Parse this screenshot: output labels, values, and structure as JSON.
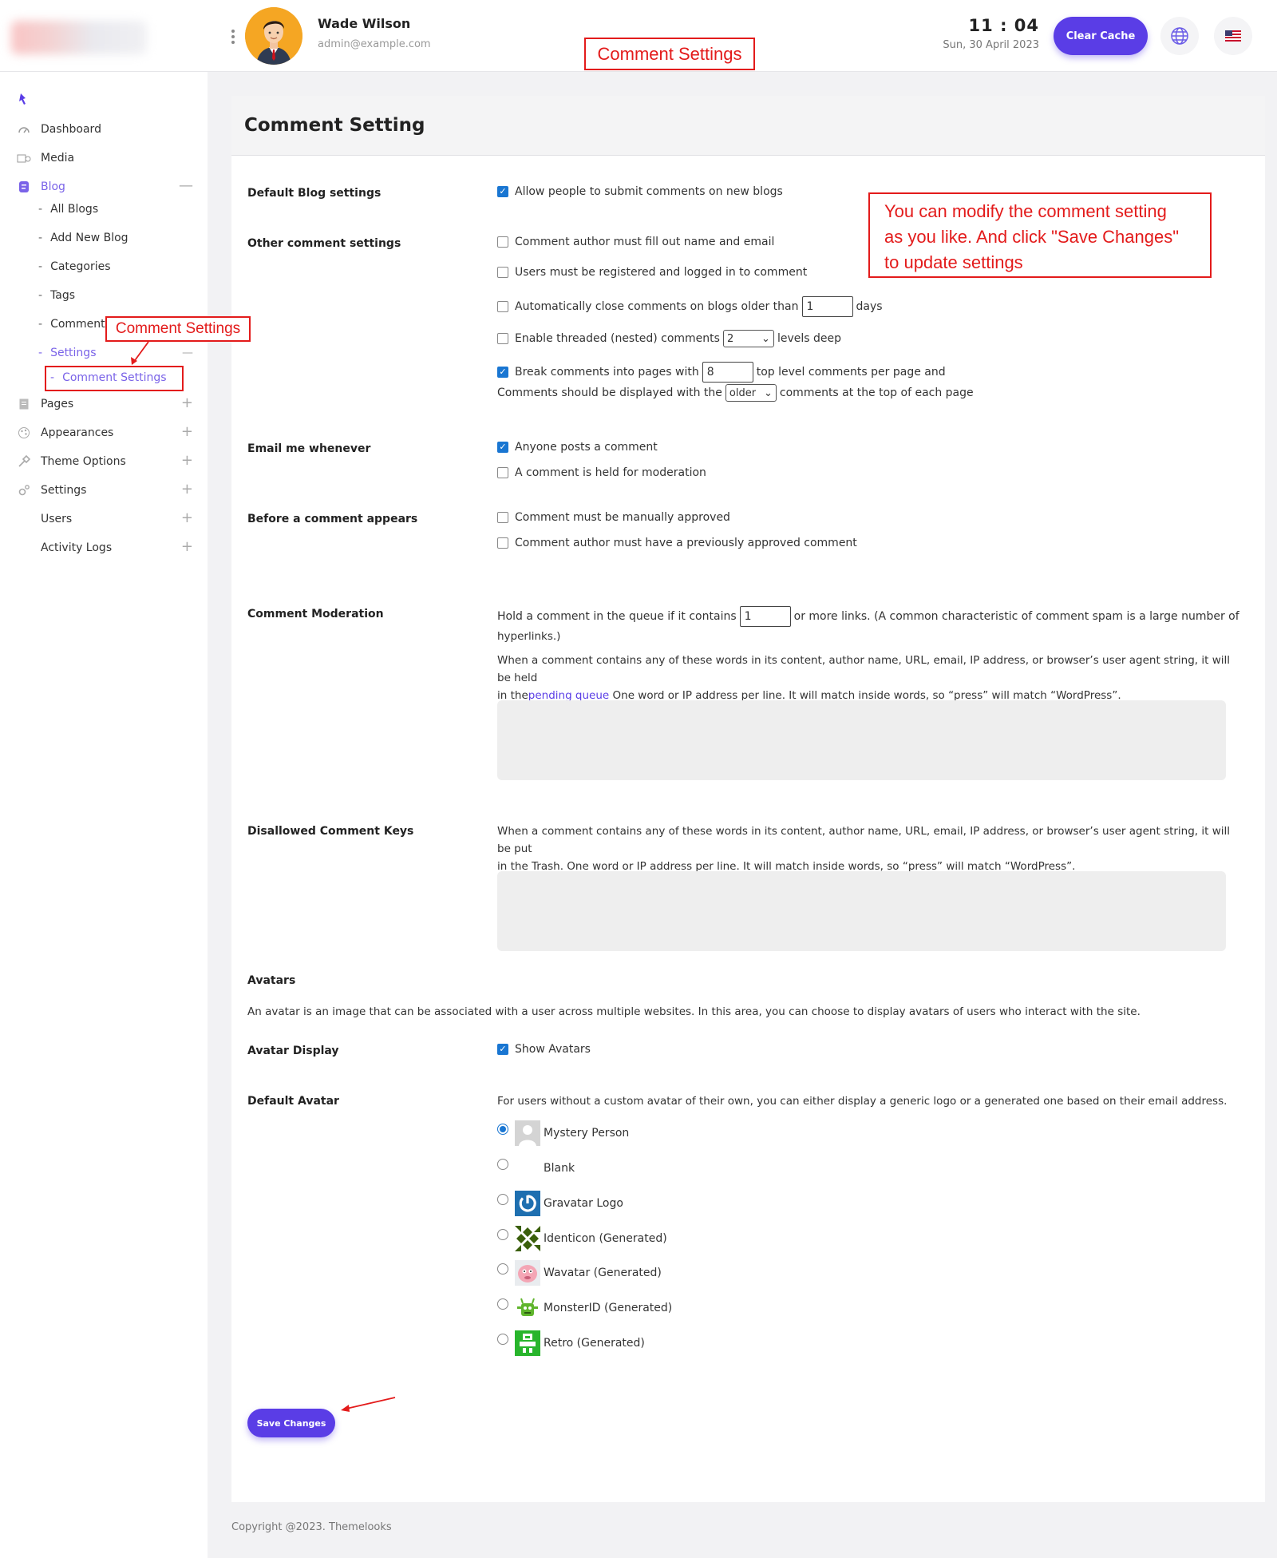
{
  "header": {
    "user_name": "Wade Wilson",
    "user_email": "admin@example.com",
    "time": "11 : 04",
    "date": "Sun, 30 April 2023",
    "clear_cache": "Clear Cache",
    "icons": [
      "more-vertical-icon",
      "globe-icon",
      "us-flag-icon"
    ]
  },
  "sidebar": {
    "items": [
      {
        "label": "Dashboard",
        "icon": "dashboard-icon"
      },
      {
        "label": "Media",
        "icon": "media-icon"
      },
      {
        "label": "Blog",
        "icon": "blog-icon",
        "expanded": true
      },
      {
        "label": "Pages",
        "icon": "pages-icon"
      },
      {
        "label": "Appearances",
        "icon": "appearances-icon"
      },
      {
        "label": "Theme Options",
        "icon": "theme-options-icon"
      },
      {
        "label": "Settings",
        "icon": "settings-icon"
      },
      {
        "label": "Users"
      },
      {
        "label": "Activity Logs"
      }
    ],
    "blog_sub": [
      "All Blogs",
      "Add New Blog",
      "Categories",
      "Tags",
      "Comments",
      "Settings"
    ],
    "settings_sub": [
      "Comment Settings"
    ]
  },
  "page": {
    "title": "Comment Setting",
    "default_blog": {
      "label": "Default Blog settings",
      "allow": "Allow people to submit comments on new blogs"
    },
    "other": {
      "label": "Other comment settings",
      "require_name": "Comment author must fill out name and email",
      "registered": "Users must be registered and logged in to comment",
      "auto_close_pre": "Automatically close comments on blogs older than",
      "auto_close_value": "1",
      "auto_close_post": "days",
      "threaded_pre": "Enable threaded (nested) comments",
      "threaded_value": "2",
      "threaded_post": "levels deep",
      "pages_pre": "Break comments into pages with",
      "pages_value": "8",
      "pages_post": "top level comments per page and",
      "order_pre": "Comments should be displayed with the",
      "order_value": "older",
      "order_post": "comments at the top of each page"
    },
    "email": {
      "label": "Email me whenever",
      "anyone": "Anyone posts a comment",
      "held": "A comment is held for moderation"
    },
    "before": {
      "label": "Before a comment appears",
      "manual": "Comment must be manually approved",
      "previous": "Comment author must have a previously approved comment"
    },
    "moderation": {
      "label": "Comment Moderation",
      "hold_pre": "Hold a comment in the queue if it contains",
      "hold_value": "1",
      "hold_post": "or more links. (A common characteristic of comment spam is a large number of",
      "hold_post2": "hyperlinks.)",
      "desc_1": "When a comment contains any of these words in its content, author name, URL, email, IP address, or browser’s user agent string, it will be held",
      "desc_2_pre": "in the",
      "desc_link": "pending queue",
      "desc_2_post": " One word or IP address per line. It will match inside words, so “press” will match “WordPress”."
    },
    "disallowed": {
      "label": "Disallowed Comment Keys",
      "desc_1": "When a comment contains any of these words in its content, author name, URL, email, IP address, or browser’s user agent string, it will be put",
      "desc_2": "in the Trash. One word or IP address per line. It will match inside words, so “press” will match “WordPress”."
    },
    "avatars": {
      "heading": "Avatars",
      "desc": "An avatar is an image that can be associated with a user across multiple websites. In this area, you can choose to display avatars of users who interact with the site.",
      "display_label": "Avatar Display",
      "show": "Show Avatars",
      "default_label": "Default Avatar",
      "default_desc": "For users without a custom avatar of their own, you can either display a generic logo or a generated one based on their email address.",
      "options": [
        "Mystery Person",
        "Blank",
        "Gravatar Logo",
        "Identicon (Generated)",
        "Wavatar (Generated)",
        "MonsterID (Generated)",
        "Retro (Generated)"
      ]
    },
    "save": "Save Changes"
  },
  "footer": "Copyright @2023. Themelooks",
  "annotations": {
    "top": "Comment Settings",
    "sidebar": "Comment Settings",
    "note": [
      "You can modify the comment setting",
      "as you like. And click \"Save Changes\"",
      "to update settings"
    ]
  },
  "colors": {
    "accent": "#5a3de6",
    "checkbox": "#1976d2",
    "annotation": "#e31b1b"
  }
}
